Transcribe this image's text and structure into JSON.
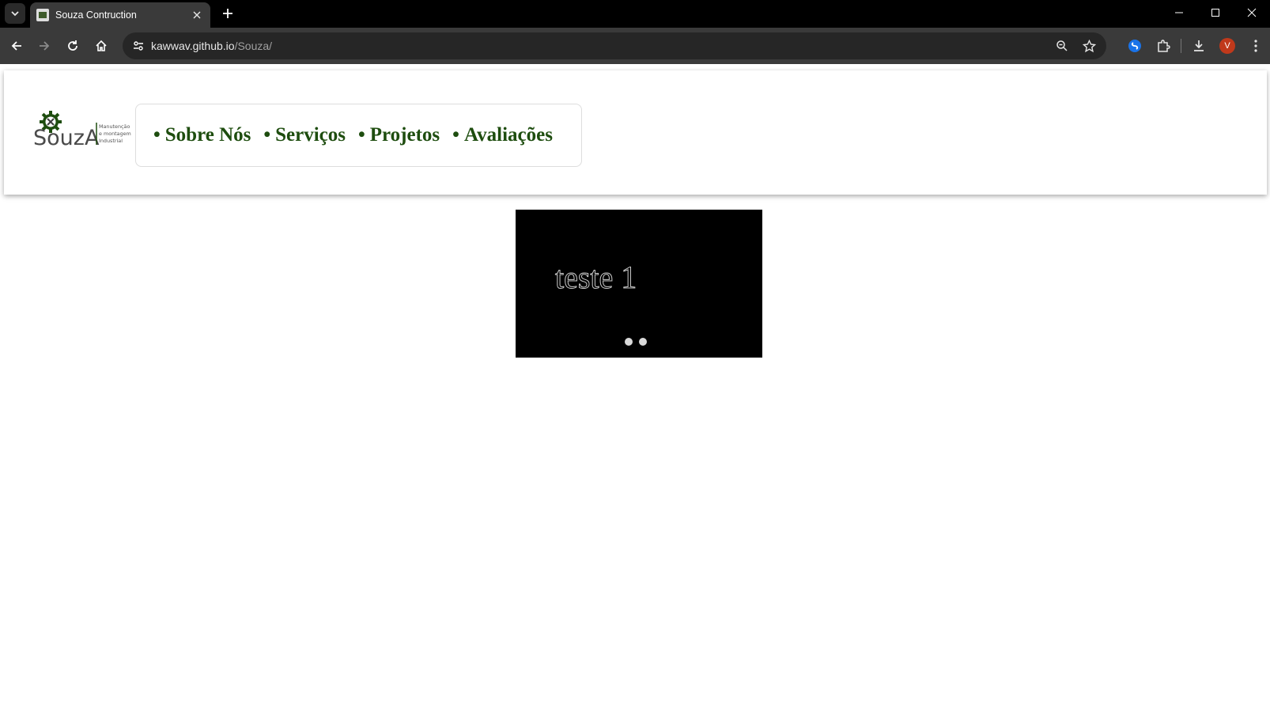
{
  "browser": {
    "tab_title": "Souza Contruction",
    "url_host": "kawwav.github.io",
    "url_path": "/Souza/",
    "profile_initial": "V"
  },
  "site": {
    "logo": {
      "wordmark": "SouzA",
      "tagline": [
        "Manutenção",
        "e montagem",
        "Industrial"
      ],
      "brand_color": "#1e4d0f"
    },
    "nav": [
      {
        "bullet": "•",
        "label": "Sobre Nós"
      },
      {
        "bullet": "•",
        "label": "Serviços"
      },
      {
        "bullet": "•",
        "label": "Projetos"
      },
      {
        "bullet": "•",
        "label": "Avaliações"
      }
    ],
    "slider": {
      "current_slide_text": "teste 1",
      "slide_count": 2
    }
  },
  "icons": {
    "tab_search": "chevron-down-icon",
    "new_tab": "plus-icon",
    "minimize": "minimize-icon",
    "maximize": "maximize-icon",
    "close": "close-icon",
    "back": "arrow-left-icon",
    "forward": "arrow-right-icon",
    "reload": "reload-icon",
    "home": "home-icon",
    "site_info": "tune-icon",
    "zoom": "zoom-icon",
    "bookmark": "star-icon",
    "extension_shazam": "shazam-icon",
    "extensions": "puzzle-icon",
    "downloads": "download-icon",
    "menu": "more-vertical-icon"
  }
}
